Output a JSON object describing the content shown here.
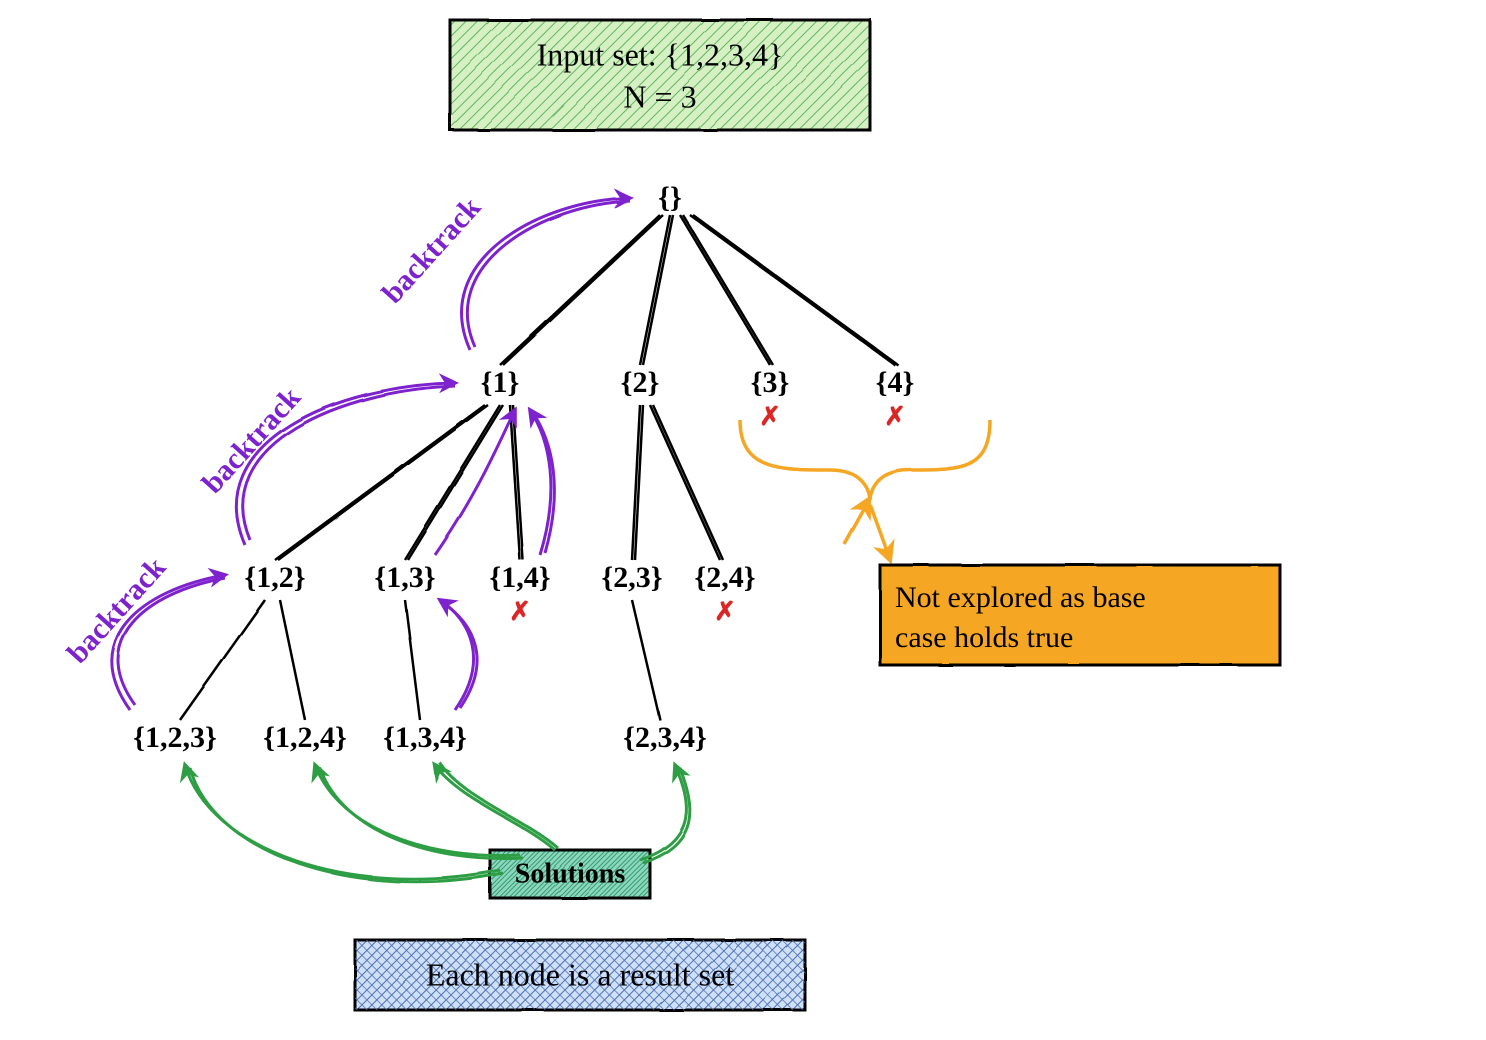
{
  "title_box": {
    "line1": "Input set: {1,2,3,4}",
    "line2": "N = 3"
  },
  "nodes": {
    "root": "{}",
    "n1": "{1}",
    "n2": "{2}",
    "n3": "{3}",
    "n4": "{4}",
    "n12": "{1,2}",
    "n13": "{1,3}",
    "n14": "{1,4}",
    "n23": "{2,3}",
    "n24": "{2,4}",
    "n123": "{1,2,3}",
    "n124": "{1,2,4}",
    "n134": "{1,3,4}",
    "n234": "{2,3,4}"
  },
  "pruned": {
    "n3": true,
    "n4": true,
    "n14": true,
    "n24": true
  },
  "labels": {
    "backtrack": "backtrack",
    "solutions": "Solutions",
    "not_explored_line1": "Not explored as base",
    "not_explored_line2": "case holds true",
    "footer": "Each node is a result set"
  },
  "colors": {
    "green_fill": "#a7e28b",
    "green_stroke": "#3a7d1f",
    "green_arrow": "#2f9e44",
    "teal_fill": "#5fbf9f",
    "teal_stroke": "#1f7a5a",
    "blue_fill": "#7ea6e0",
    "blue_stroke": "#2b4b8f",
    "orange_fill": "#f5a623",
    "orange_stroke": "#c77d00",
    "purple": "#7e22ce",
    "red": "#dc2626",
    "black": "#000000"
  }
}
